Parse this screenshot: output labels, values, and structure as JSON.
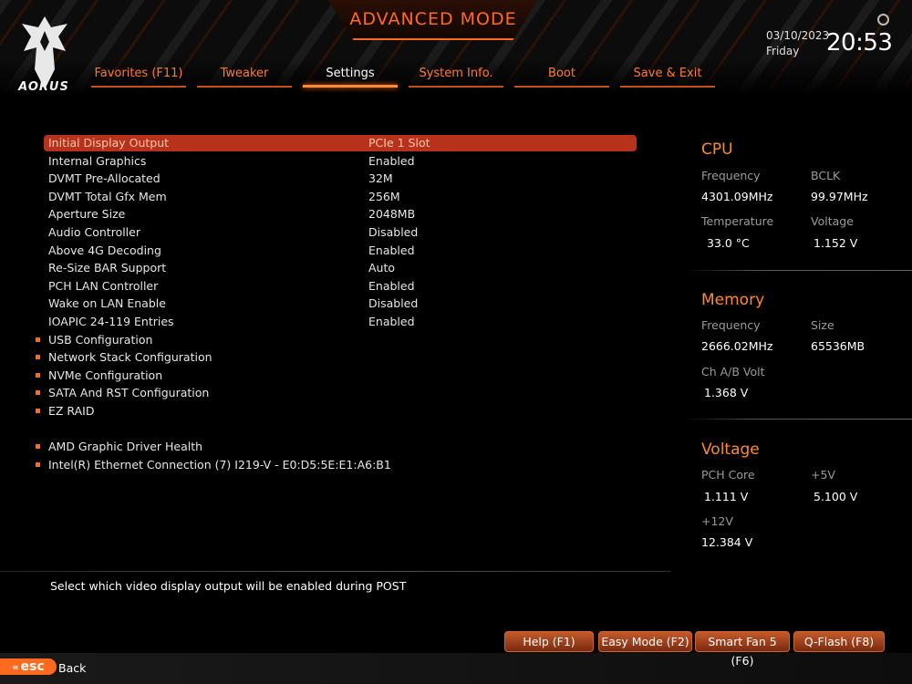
{
  "header": {
    "logo_text": "AORUS",
    "mode_title": "ADVANCED MODE",
    "date": "03/10/2023",
    "day": "Friday",
    "time": "20:53"
  },
  "tabs": [
    {
      "label": "Favorites (F11)",
      "active": false
    },
    {
      "label": "Tweaker",
      "active": false
    },
    {
      "label": "Settings",
      "active": true
    },
    {
      "label": "System Info.",
      "active": false
    },
    {
      "label": "Boot",
      "active": false
    },
    {
      "label": "Save & Exit",
      "active": false
    }
  ],
  "settings": {
    "items": [
      {
        "label": "Initial Display Output",
        "value": "PCIe 1 Slot",
        "selected": true,
        "submenu": false
      },
      {
        "label": "Internal Graphics",
        "value": "Enabled",
        "submenu": false
      },
      {
        "label": "DVMT Pre-Allocated",
        "value": "32M",
        "submenu": false
      },
      {
        "label": "DVMT Total Gfx Mem",
        "value": "256M",
        "submenu": false
      },
      {
        "label": "Aperture Size",
        "value": "2048MB",
        "submenu": false
      },
      {
        "label": "Audio Controller",
        "value": "Disabled",
        "submenu": false
      },
      {
        "label": "Above 4G Decoding",
        "value": "Enabled",
        "submenu": false
      },
      {
        "label": "Re-Size BAR Support",
        "value": "Auto",
        "submenu": false
      },
      {
        "label": "PCH LAN Controller",
        "value": "Enabled",
        "submenu": false
      },
      {
        "label": "Wake on LAN Enable",
        "value": "Disabled",
        "submenu": false
      },
      {
        "label": "IOAPIC 24-119 Entries",
        "value": "Enabled",
        "submenu": false
      },
      {
        "label": "USB Configuration",
        "value": "",
        "submenu": true
      },
      {
        "label": "Network Stack Configuration",
        "value": "",
        "submenu": true
      },
      {
        "label": "NVMe Configuration",
        "value": "",
        "submenu": true
      },
      {
        "label": "SATA And RST Configuration",
        "value": "",
        "submenu": true
      },
      {
        "label": "EZ RAID",
        "value": "",
        "submenu": true
      },
      {
        "label": "AMD Graphic Driver Health",
        "value": "",
        "submenu": true
      },
      {
        "label": "Intel(R) Ethernet Connection (7) I219-V - E0:D5:5E:E1:A6:B1",
        "value": "",
        "submenu": true
      }
    ]
  },
  "panel": {
    "cpu": {
      "title": "CPU",
      "frequency_label": "Frequency",
      "frequency": "4301.09MHz",
      "bclk_label": "BCLK",
      "bclk": "99.97MHz",
      "temperature_label": "Temperature",
      "temperature": "33.0 °C",
      "voltage_label": "Voltage",
      "voltage": "1.152 V"
    },
    "memory": {
      "title": "Memory",
      "frequency_label": "Frequency",
      "frequency": "2666.02MHz",
      "size_label": "Size",
      "size": "65536MB",
      "volt_label": "Ch A/B Volt",
      "volt": "1.368 V"
    },
    "voltage": {
      "title": "Voltage",
      "pch_label": "PCH Core",
      "pch": "1.111 V",
      "v5_label": "+5V",
      "v5": "5.100 V",
      "v12_label": "+12V",
      "v12": "12.384 V"
    }
  },
  "help_text": "Select which video display output will be enabled during POST",
  "buttons": {
    "help": "Help (F1)",
    "easy_mode": "Easy Mode (F2)",
    "smart_fan": "Smart Fan 5 (F6)",
    "qflash": "Q-Flash (F8)",
    "esc": "esc",
    "back": "Back"
  },
  "colors": {
    "accent": "#ff6a1f",
    "selected_row": "#b8321b",
    "tab_text": "#ff7a2a"
  }
}
